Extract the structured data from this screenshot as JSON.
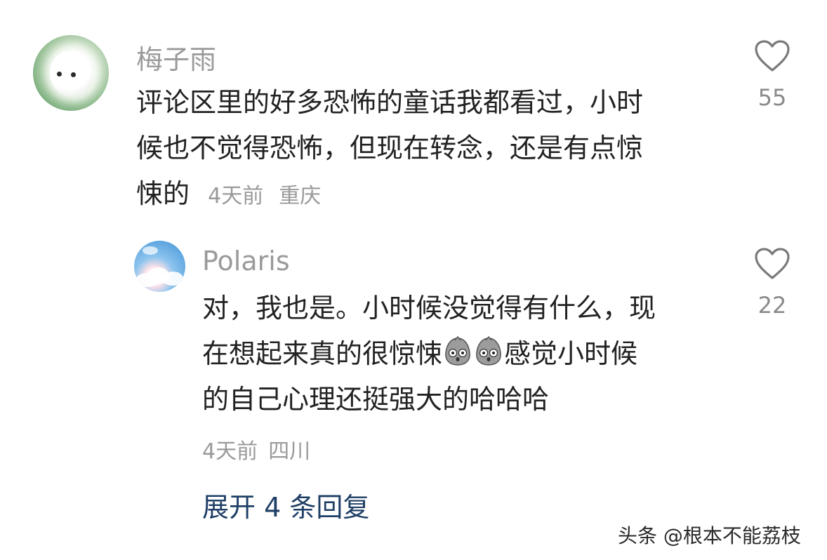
{
  "comment": {
    "username": "梅子雨",
    "lines": [
      "评论区里的好多恐怖的童话我都看过，小时",
      "候也不觉得恐怖，但现在转念，还是有点惊",
      "悚的"
    ],
    "time": "4天前",
    "location": "重庆",
    "like_count": "55"
  },
  "reply": {
    "username": "Polaris",
    "line1": "对，我也是。小时候没觉得有什么，现",
    "line2_part1": "在想起来真的很惊悚",
    "line2_part2": "感觉小时候",
    "line3": "的自己心理还挺强大的哈哈哈",
    "time": "4天前",
    "location": "四川",
    "like_count": "22"
  },
  "expand_label": "展开 4 条回复",
  "watermark": "头条 @根本不能荔枝",
  "icons": {
    "like": "heart-outline-icon",
    "emoji": "scared-face-emoji-icon"
  },
  "colors": {
    "username": "#9a9a9a",
    "text": "#222222",
    "link": "#1f3f66"
  }
}
